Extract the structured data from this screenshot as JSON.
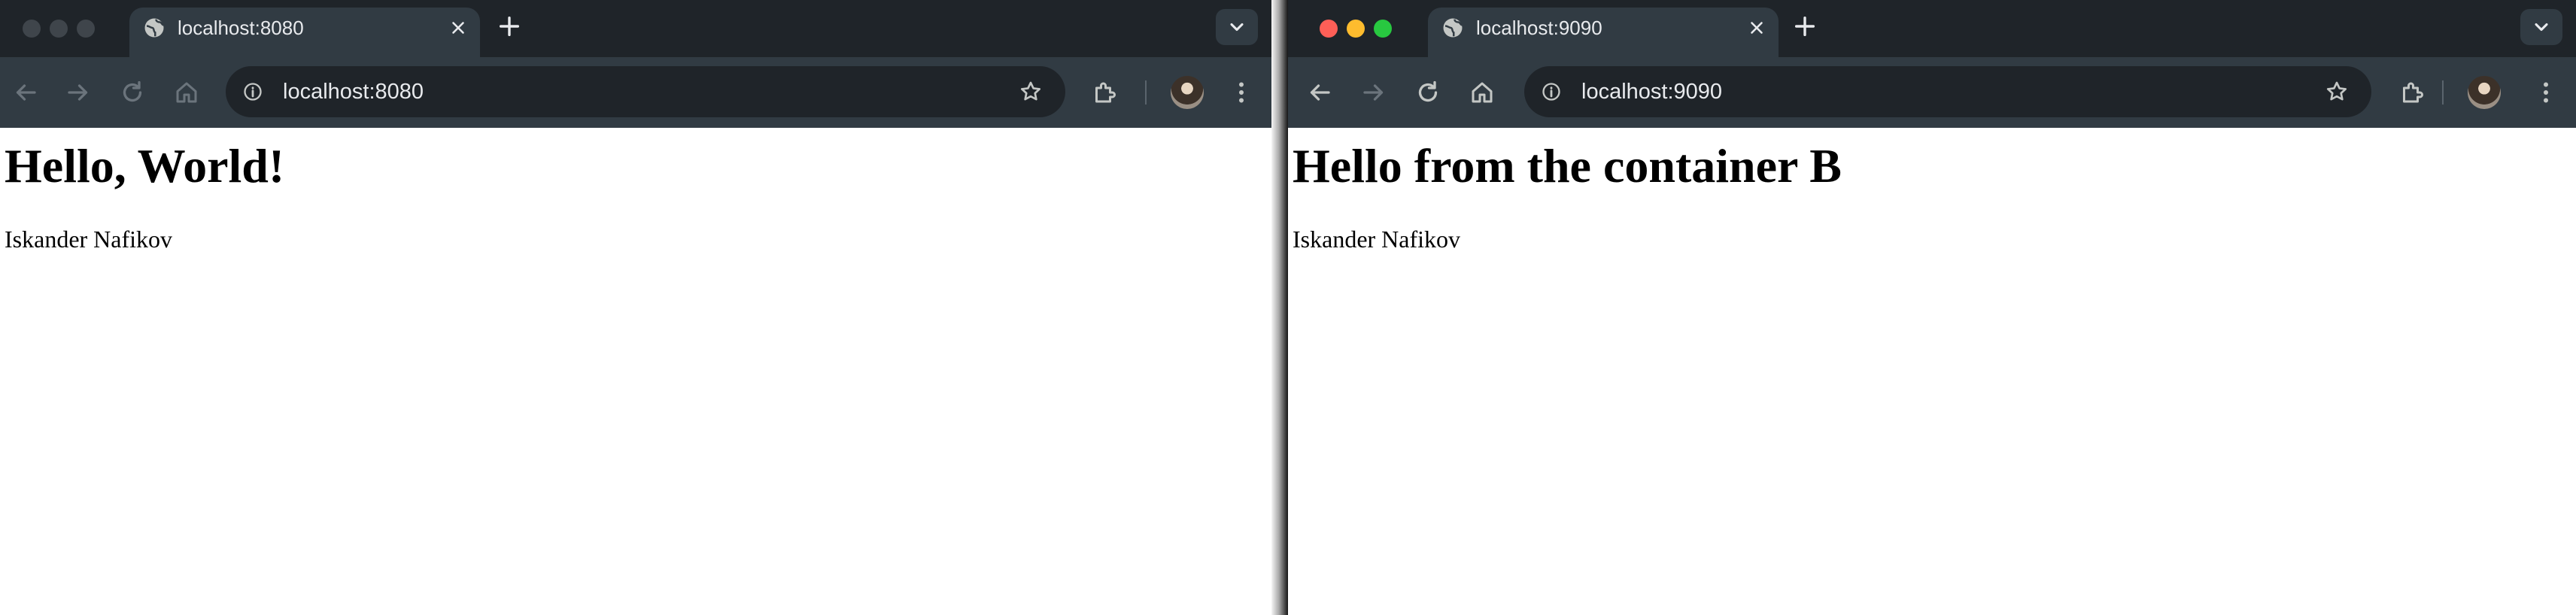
{
  "windows": [
    {
      "tab_title": "localhost:8080",
      "url": "localhost:8080",
      "page": {
        "heading": "Hello, World!",
        "text": "Iskander Nafikov"
      }
    },
    {
      "tab_title": "localhost:9090",
      "url": "localhost:9090",
      "page": {
        "heading": "Hello from the container B",
        "text": "Iskander Nafikov"
      }
    }
  ],
  "icons": {
    "tab_favicon": "globe-icon",
    "tab_close": "close-icon",
    "new_tab": "plus-icon",
    "tab_search": "chevron-down-icon",
    "back": "back-arrow-icon",
    "forward": "forward-arrow-icon",
    "reload": "reload-icon",
    "home": "home-icon",
    "site_info": "info-icon",
    "bookmark": "star-icon",
    "extensions": "puzzle-icon",
    "profile": "avatar",
    "menu": "kebab-menu-icon"
  },
  "colors": {
    "tabstrip": "#1f2429",
    "toolbar": "#313b43",
    "omnibox": "#1f2429",
    "icon": "#c4c7c5",
    "icon_disabled": "#6b747c",
    "traffic_red": "#fe5f57",
    "traffic_yellow": "#febc2e",
    "traffic_green": "#28c840"
  }
}
